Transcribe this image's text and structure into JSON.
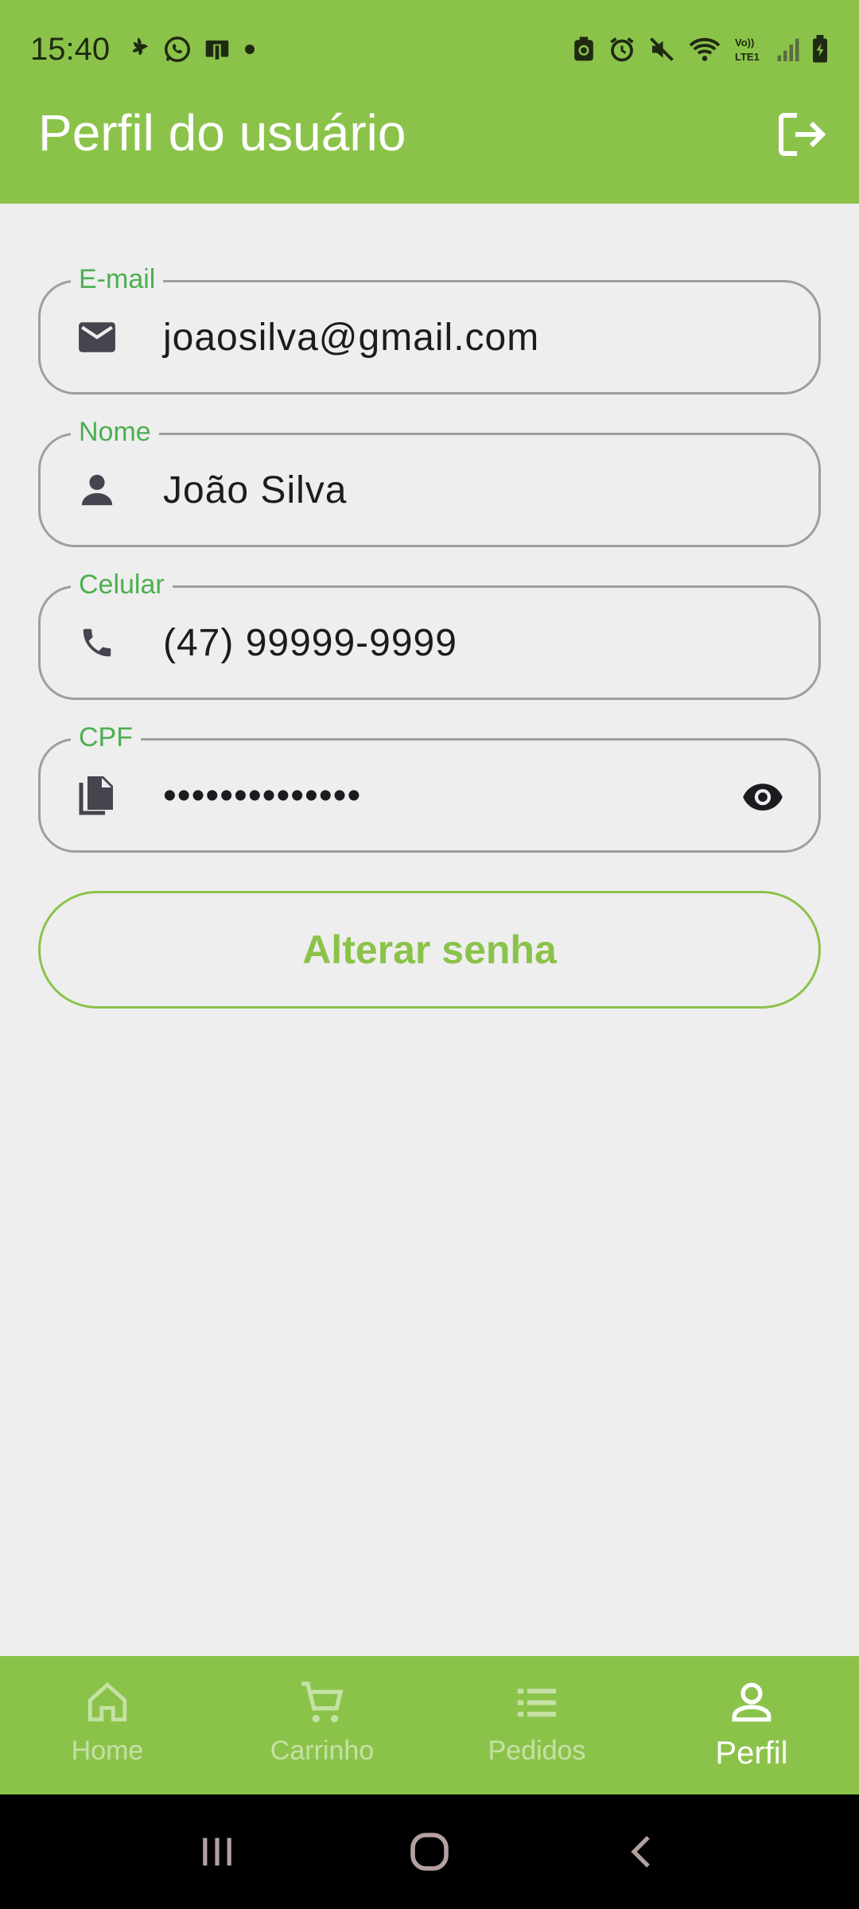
{
  "status_bar": {
    "time": "15:40",
    "left_icons": [
      "leaf-icon",
      "whatsapp-icon",
      "wallet-icon",
      "dot-icon"
    ],
    "right_icons": [
      "recycle-icon",
      "alarm-icon",
      "mute-icon",
      "wifi-icon",
      "volte-icon",
      "signal-icon",
      "battery-icon"
    ],
    "volte_text": "Vo)) LTE1"
  },
  "header": {
    "title": "Perfil do usuário",
    "action_icon": "logout-icon"
  },
  "form": {
    "email": {
      "label": "E-mail",
      "value": "joaosilva@gmail.com",
      "icon": "mail-icon"
    },
    "name": {
      "label": "Nome",
      "value": "João Silva",
      "icon": "person-icon"
    },
    "phone": {
      "label": "Celular",
      "value": "(47) 99999-9999",
      "icon": "phone-icon"
    },
    "cpf": {
      "label": "CPF",
      "value": "••••••••••••••",
      "icon": "file-copy-icon",
      "toggle_icon": "eye-icon"
    }
  },
  "change_password_label": "Alterar senha",
  "bottom_nav": {
    "items": [
      {
        "label": "Home",
        "icon": "home-icon",
        "active": false
      },
      {
        "label": "Carrinho",
        "icon": "cart-icon",
        "active": false
      },
      {
        "label": "Pedidos",
        "icon": "list-icon",
        "active": false
      },
      {
        "label": "Perfil",
        "icon": "person-outline-icon",
        "active": true
      }
    ]
  },
  "system_nav": [
    "recents-icon",
    "home-circle-icon",
    "back-icon"
  ],
  "colors": {
    "primary": "#8bc34a",
    "label_green": "#4caf50",
    "background": "#eeeeee",
    "inactive_nav": "#c5e1a5"
  }
}
